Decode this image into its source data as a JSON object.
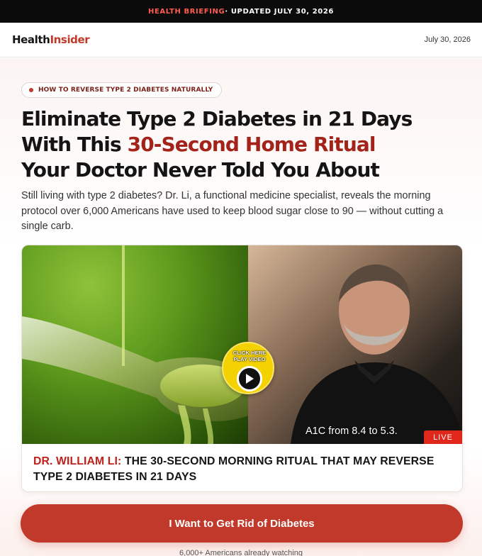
{
  "topbar": {
    "accent": "HEALTH BRIEFING",
    "rest": " · UPDATED JULY 30, 2026"
  },
  "header": {
    "logo_part1": "Health",
    "logo_part2": "Insider",
    "date": "July 30, 2026"
  },
  "pill": {
    "text": "HOW TO REVERSE TYPE 2 DIABETES NATURALLY"
  },
  "headline": {
    "line1": "Eliminate Type 2 Diabetes in 21 Days",
    "line2_pre": "With This ",
    "line2_highlight": "30-Second Home Ritual",
    "line3": "Your Doctor Never Told You About"
  },
  "subheadline": "Still living with type 2 diabetes? Dr. Li, a functional medicine specialist, reveals the morning protocol over 6,000 Americans have used to keep blood sugar close to 90 — without cutting a single carb.",
  "video": {
    "overlay_text": "A1C from 8.4 to 5.3.",
    "live_badge": "LIVE",
    "play_line1": "CLICK HERE",
    "play_line2": "PLAY VIDEO",
    "caption_name": "DR. WILLIAM LI:",
    "caption_text": " THE 30-SECOND MORNING RITUAL THAT MAY REVERSE TYPE 2 DIABETES IN 21 DAYS"
  },
  "cta": {
    "label": "I Want to Get Rid of Diabetes"
  },
  "social_proof": "6,000+ Americans already watching",
  "colors": {
    "brand_red": "#c0392b",
    "dark": "#0b0b0b",
    "live_red": "#e0271b",
    "play_yellow": "#f4d100"
  }
}
